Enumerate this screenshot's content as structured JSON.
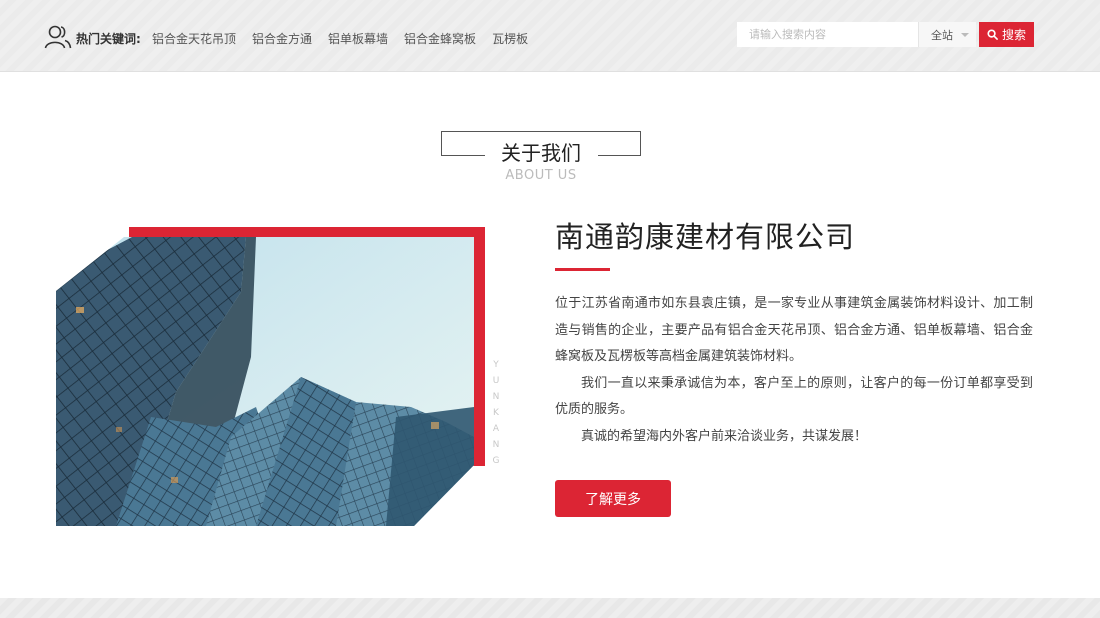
{
  "header": {
    "keywords_title": "热门关键词:",
    "keywords": [
      "铝合金天花吊顶",
      "铝合金方通",
      "铝单板幕墙",
      "铝合金蜂窝板",
      "瓦楞板"
    ],
    "search": {
      "placeholder": "请输入搜索内容",
      "scope": "全站",
      "button_label": "搜索"
    }
  },
  "about": {
    "heading": "关于我们",
    "subheading": "ABOUT US",
    "vertical_text": "YUNKANG",
    "company_name": "南通韵康建材有限公司",
    "paragraphs": [
      "位于江苏省南通市如东县袁庄镇，是一家专业从事建筑金属装饰材料设计、加工制造与销售的企业，主要产品有铝合金天花吊顶、铝合金方通、铝单板幕墙、铝合金蜂窝板及瓦楞板等高档金属建筑装饰材料。",
      "我们一直以来秉承诚信为本，客户至上的原则，让客户的每一份订单都享受到优质的服务。",
      "真诚的希望海内外客户前来洽谈业务，共谋发展！"
    ],
    "more_button": "了解更多"
  },
  "colors": {
    "accent": "#dc2534",
    "topbar_bg": "#eeeeee"
  },
  "icons": {
    "keywords": "users-icon",
    "search": "search-icon",
    "dropdown": "caret-down-icon"
  }
}
